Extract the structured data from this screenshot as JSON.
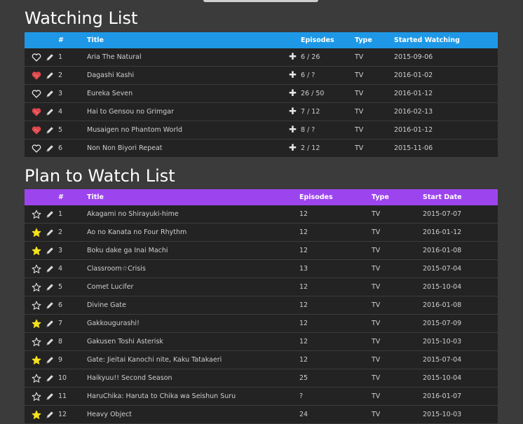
{
  "colors": {
    "watching_header": "#1e98e6",
    "plan_header": "#9c45ee",
    "favorite": "#e0474c",
    "star": "#f5e11c"
  },
  "watching": {
    "title": "Watching List",
    "columns": {
      "num": "#",
      "title": "Title",
      "episodes": "Episodes",
      "type": "Type",
      "date": "Started Watching"
    },
    "rows": [
      {
        "num": "1",
        "title": "Aria The Natural",
        "episodes": "6 / 26",
        "type": "TV",
        "date": "2015-09-06",
        "favorite": false
      },
      {
        "num": "2",
        "title": "Dagashi Kashi",
        "episodes": "6 / ?",
        "type": "TV",
        "date": "2016-01-02",
        "favorite": true
      },
      {
        "num": "3",
        "title": "Eureka Seven",
        "episodes": "26 / 50",
        "type": "TV",
        "date": "2016-01-12",
        "favorite": false
      },
      {
        "num": "4",
        "title": "Hai to Gensou no Grimgar",
        "episodes": "7 / 12",
        "type": "TV",
        "date": "2016-02-13",
        "favorite": true
      },
      {
        "num": "5",
        "title": "Musaigen no Phantom World",
        "episodes": "8 / ?",
        "type": "TV",
        "date": "2016-01-12",
        "favorite": true
      },
      {
        "num": "6",
        "title": "Non Non Biyori Repeat",
        "episodes": "2 / 12",
        "type": "TV",
        "date": "2015-11-06",
        "favorite": false
      }
    ]
  },
  "plan": {
    "title": "Plan to Watch List",
    "columns": {
      "num": "#",
      "title": "Title",
      "episodes": "Episodes",
      "type": "Type",
      "date": "Start Date"
    },
    "rows": [
      {
        "num": "1",
        "title": "Akagami no Shirayuki-hime",
        "episodes": "12",
        "type": "TV",
        "date": "2015-07-07",
        "starred": false
      },
      {
        "num": "2",
        "title": "Ao no Kanata no Four Rhythm",
        "episodes": "12",
        "type": "TV",
        "date": "2016-01-12",
        "starred": true
      },
      {
        "num": "3",
        "title": "Boku dake ga Inai Machi",
        "episodes": "12",
        "type": "TV",
        "date": "2016-01-08",
        "starred": true
      },
      {
        "num": "4",
        "title": "Classroom☆Crisis",
        "episodes": "13",
        "type": "TV",
        "date": "2015-07-04",
        "starred": false
      },
      {
        "num": "5",
        "title": "Comet Lucifer",
        "episodes": "12",
        "type": "TV",
        "date": "2015-10-04",
        "starred": false
      },
      {
        "num": "6",
        "title": "Divine Gate",
        "episodes": "12",
        "type": "TV",
        "date": "2016-01-08",
        "starred": false
      },
      {
        "num": "7",
        "title": "Gakkougurashi!",
        "episodes": "12",
        "type": "TV",
        "date": "2015-07-09",
        "starred": true
      },
      {
        "num": "8",
        "title": "Gakusen Toshi Asterisk",
        "episodes": "12",
        "type": "TV",
        "date": "2015-10-03",
        "starred": false
      },
      {
        "num": "9",
        "title": "Gate: Jieitai Kanochi nite, Kaku Tatakaeri",
        "episodes": "12",
        "type": "TV",
        "date": "2015-07-04",
        "starred": true
      },
      {
        "num": "10",
        "title": "Haikyuu!! Second Season",
        "episodes": "25",
        "type": "TV",
        "date": "2015-10-04",
        "starred": false
      },
      {
        "num": "11",
        "title": "HaruChika: Haruta to Chika wa Seishun Suru",
        "episodes": "?",
        "type": "TV",
        "date": "2016-01-07",
        "starred": false
      },
      {
        "num": "12",
        "title": "Heavy Object",
        "episodes": "24",
        "type": "TV",
        "date": "2015-10-03",
        "starred": true
      }
    ]
  }
}
